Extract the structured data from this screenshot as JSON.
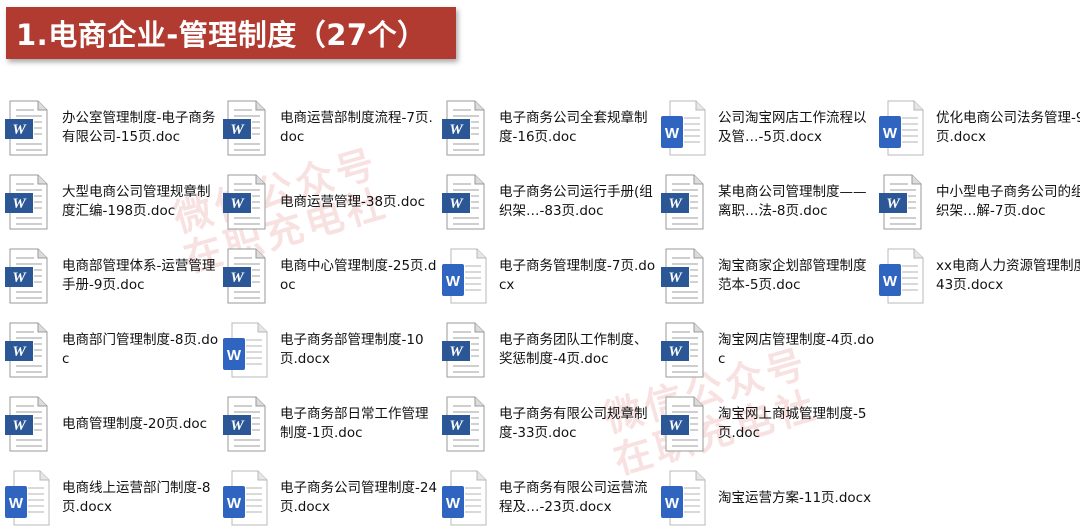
{
  "header": {
    "title": "1.电商企业-管理制度（27个）"
  },
  "watermarks": [
    "微信公众号",
    "在职充电社",
    "微信公众号",
    "在职充电社"
  ],
  "files": [
    {
      "name": "办公室管理制度-电子商务有限公司-15页.doc",
      "icon": "word-doc-icon"
    },
    {
      "name": "电商运营部制度流程-7页.doc",
      "icon": "word-doc-icon"
    },
    {
      "name": "电子商务公司全套规章制度-16页.doc",
      "icon": "word-doc-icon"
    },
    {
      "name": "公司淘宝网店工作流程以及管…-5页.docx",
      "icon": "word-docx-icon"
    },
    {
      "name": "优化电商公司法务管理-9页.docx",
      "icon": "word-docx-icon"
    },
    {
      "name": "大型电商公司管理规章制度汇编-198页.doc",
      "icon": "word-doc-icon"
    },
    {
      "name": "电商运营管理-38页.doc",
      "icon": "word-doc-icon"
    },
    {
      "name": "电子商务公司运行手册(组织架…-83页.doc",
      "icon": "word-doc-icon"
    },
    {
      "name": "某电商公司管理制度——离职…法-8页.doc",
      "icon": "word-doc-icon"
    },
    {
      "name": "中小型电子商务公司的组织架…解-7页.doc",
      "icon": "word-doc-icon"
    },
    {
      "name": "电商部管理体系-运营管理手册-9页.doc",
      "icon": "word-doc-icon"
    },
    {
      "name": "电商中心管理制度-25页.doc",
      "icon": "word-doc-icon"
    },
    {
      "name": "电子商务管理制度-7页.docx",
      "icon": "word-docx-icon"
    },
    {
      "name": "淘宝商家企划部管理制度范本-5页.doc",
      "icon": "word-doc-icon"
    },
    {
      "name": "xx电商人力资源管理制度-43页.docx",
      "icon": "word-docx-icon"
    },
    {
      "name": "电商部门管理制度-8页.doc",
      "icon": "word-doc-icon"
    },
    {
      "name": "电子商务部管理制度-10页.docx",
      "icon": "word-docx-icon"
    },
    {
      "name": "电子商务团队工作制度、奖惩制度-4页.doc",
      "icon": "word-doc-icon"
    },
    {
      "name": "淘宝网店管理制度-4页.doc",
      "icon": "word-doc-icon"
    },
    null,
    {
      "name": "电商管理制度-20页.doc",
      "icon": "word-doc-icon"
    },
    {
      "name": "电子商务部日常工作管理制度-1页.doc",
      "icon": "word-doc-icon"
    },
    {
      "name": "电子商务有限公司规章制度-33页.doc",
      "icon": "word-doc-icon"
    },
    {
      "name": "淘宝网上商城管理制度-5页.doc",
      "icon": "word-doc-icon"
    },
    null,
    {
      "name": "电商线上运营部门制度-8页.docx",
      "icon": "word-docx-icon"
    },
    {
      "name": "电子商务公司管理制度-24页.docx",
      "icon": "word-docx-icon"
    },
    {
      "name": "电子商务有限公司运营流程及…-23页.docx",
      "icon": "word-docx-icon"
    },
    {
      "name": "淘宝运营方案-11页.docx",
      "icon": "word-docx-icon"
    },
    null
  ],
  "colors": {
    "header_bg": "#b13a31",
    "word_blue": "#2b5797",
    "word_docx_blue": "#2f64c0"
  }
}
